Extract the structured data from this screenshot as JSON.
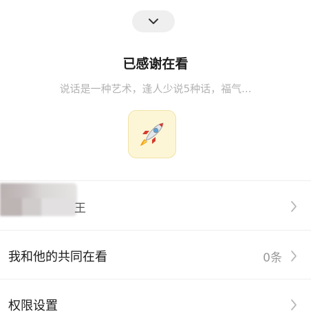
{
  "header": {
    "collapse_icon": "chevron-down-icon",
    "title": "已感谢在看",
    "subtitle": "说话是一种艺术，逢人少说5种话，福气..."
  },
  "sticker": {
    "icon": "rocket-icon",
    "glyph": "🚀",
    "background": "#fdf6d6"
  },
  "rows": [
    {
      "label": "王",
      "value": "",
      "icon": "chevron-right-icon"
    },
    {
      "label": "我和他的共同在看",
      "value": "0条",
      "icon": "chevron-right-icon"
    },
    {
      "label": "权限设置",
      "value": "",
      "icon": "chevron-right-icon"
    }
  ]
}
